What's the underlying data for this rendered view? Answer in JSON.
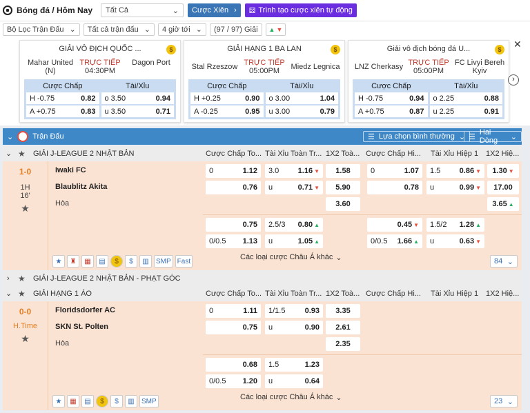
{
  "header": {
    "title": "Bóng đá / Hôm Nay",
    "filter_value": "Tất Cả",
    "parlay_button": "Cược Xiên",
    "auto_parlay_button": "Trình tạo cược xiên tự động"
  },
  "filters": {
    "match_filter": "Bộ Lọc Trận Đấu",
    "all_matches": "Tất cả trận đấu",
    "hours": "4 giờ tới",
    "league_count": "(97 / 97) Giải"
  },
  "featured": [
    {
      "league": "GIẢI VÔ ĐỊCH QUỐC ...",
      "home": "Mahar United (N)",
      "away": "Dagon Port",
      "live": "TRỰC TIẾP",
      "time": "04:30PM",
      "hdp_label": "Cược Chấp",
      "ou_label": "Tài/Xỉu",
      "h_line": "H -0.75",
      "h_odds": "0.82",
      "a_line": "A +0.75",
      "a_odds": "0.83",
      "o_line": "o 3.50",
      "o_odds": "0.94",
      "u_line": "u 3.50",
      "u_odds": "0.71"
    },
    {
      "league": "GIẢI HẠNG 1 BA LAN",
      "home": "Stal Rzeszow",
      "away": "Miedz Legnica",
      "live": "TRỰC TIẾP",
      "time": "05:00PM",
      "hdp_label": "Cược Chấp",
      "ou_label": "Tài/Xỉu",
      "h_line": "H +0.25",
      "h_odds": "0.90",
      "a_line": "A -0.25",
      "a_odds": "0.95",
      "o_line": "o 3.00",
      "o_odds": "1.04",
      "u_line": "u 3.00",
      "u_odds": "0.79"
    },
    {
      "league": "Giải vô địch bóng đá U...",
      "home": "LNZ Cherkasy",
      "away": "FC Livyi Bereh Kyiv",
      "live": "TRỰC TIẾP",
      "time": "05:00PM",
      "hdp_label": "Cược Chấp",
      "ou_label": "Tài/Xỉu",
      "h_line": "H -0.75",
      "h_odds": "0.94",
      "a_line": "A +0.75",
      "a_odds": "0.87",
      "o_line": "o 2.25",
      "o_odds": "0.88",
      "u_line": "u 2.25",
      "u_odds": "0.91"
    }
  ],
  "main": {
    "section_title": "Trận Đấu",
    "sort_label": "Lựa chọn bình thường",
    "view_label": "Hai Dòng"
  },
  "columns": {
    "c1": "Cược Chấp To...",
    "c2": "Tài Xỉu Toàn Tr...",
    "c3": "1X2 Toà...",
    "c4": "Cược Chấp Hi...",
    "c5": "Tài Xỉu Hiệp 1",
    "c6": "1X2 Hiệ..."
  },
  "league1": {
    "name": "GIẢI J-LEAGUE 2 NHẬT BẢN",
    "score": "1-0",
    "period": "1H",
    "minute": "16'",
    "home": "Iwaki FC",
    "away": "Blaublitz Akita",
    "draw": "Hòa",
    "r1": {
      "hdp_line": "0",
      "hdp_odds": "1.12",
      "ou_line": "3.0",
      "ou_odds": "1.16",
      "x12": "1.58",
      "h1_line": "0",
      "h1_odds": "1.07",
      "h1ou_line": "1.5",
      "h1ou_odds": "0.86",
      "h1x12": "1.30"
    },
    "r2": {
      "hdp_odds": "0.76",
      "ou_line": "u",
      "ou_odds": "0.71",
      "x12": "5.90",
      "h1_odds": "0.78",
      "h1ou_line": "u",
      "h1ou_odds": "0.99",
      "h1x12": "17.00"
    },
    "r3": {
      "x12": "3.60",
      "h1x12": "3.65"
    },
    "r4": {
      "hdp_odds": "0.75",
      "ou_line": "2.5/3",
      "ou_odds": "0.80",
      "h1_odds": "0.45",
      "h1ou_line": "1.5/2",
      "h1ou_odds": "1.28"
    },
    "r5": {
      "hdp_line": "0/0.5",
      "hdp_odds": "1.13",
      "ou_line": "u",
      "ou_odds": "1.05",
      "h1_line": "0/0.5",
      "h1_odds": "1.66",
      "h1ou_line": "u",
      "h1ou_odds": "0.63"
    },
    "tools": {
      "smp": "SMP",
      "fast": "Fast"
    },
    "more": "Các loại cược Châu Á khác",
    "count": "84"
  },
  "league2": {
    "name": "GIẢI J-LEAGUE 2 NHẬT BẢN - PHẠT GÓC"
  },
  "league3": {
    "name": "GIẢI HẠNG 1 ÁO",
    "score": "0-0",
    "period": "H.Time",
    "home": "Floridsdorfer AC",
    "away": "SKN St. Polten",
    "draw": "Hòa",
    "r1": {
      "hdp_line": "0",
      "hdp_odds": "1.11",
      "ou_line": "1/1.5",
      "ou_odds": "0.93",
      "x12": "3.35"
    },
    "r2": {
      "hdp_odds": "0.75",
      "ou_line": "u",
      "ou_odds": "0.90",
      "x12": "2.61"
    },
    "r3": {
      "x12": "2.35"
    },
    "r4": {
      "hdp_odds": "0.68",
      "ou_line": "1.5",
      "ou_odds": "1.23"
    },
    "r5": {
      "hdp_line": "0/0.5",
      "hdp_odds": "1.20",
      "ou_line": "u",
      "ou_odds": "0.64"
    },
    "tools": {
      "smp": "SMP"
    },
    "more": "Các loại cược Châu Á khác",
    "count": "23"
  },
  "colors": {
    "accent": "#3f88c8",
    "parlay": "#3a76b6",
    "auto": "#6a2ee0",
    "live": "#c0392b",
    "row_bg": "#fbe3d3"
  }
}
